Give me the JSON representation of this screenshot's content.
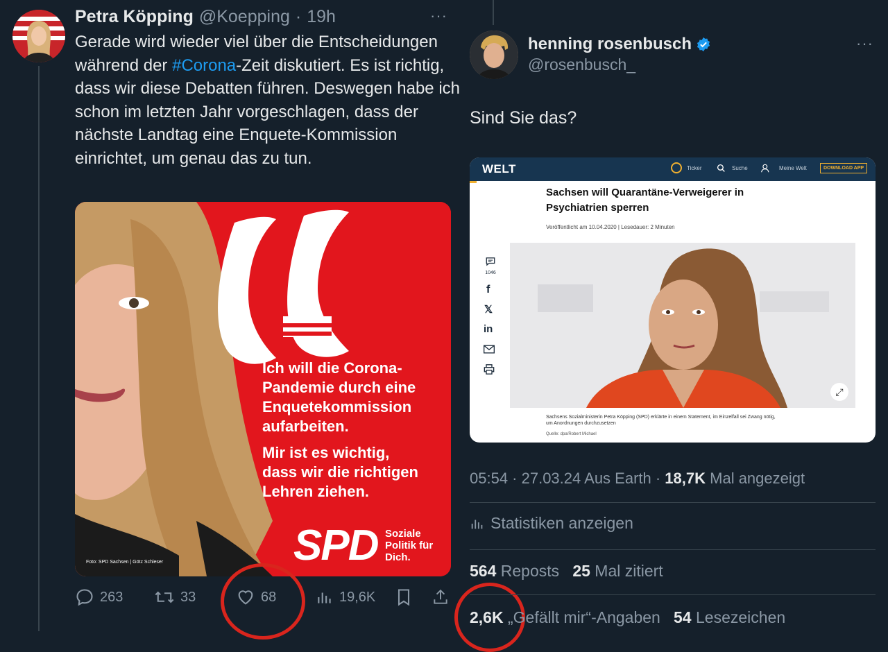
{
  "left_tweet": {
    "name": "Petra Köpping",
    "handle": "@Koepping",
    "time": "19h",
    "more": "···",
    "text_before": "Gerade wird wieder viel über die Entscheidungen während der ",
    "hashtag": "#Corona",
    "text_after": "-Zeit diskutiert. Es ist richtig, dass wir diese Debatten führen. Deswegen habe ich schon im letzten Jahr vorgeschlagen, dass der nächste Landtag eine Enquete-Kommission einrichtet, um genau das zu tun.",
    "image": {
      "quote_text_1": "Ich will die Corona-",
      "quote_text_2": "Pandemie durch eine",
      "quote_text_3": "Enquetekommission",
      "quote_text_4": "aufarbeiten.",
      "quote_text_5": "Mir ist es wichtig,",
      "quote_text_6": "dass wir die richtigen",
      "quote_text_7": "Lehren ziehen.",
      "logo": "SPD",
      "slogan_1": "Soziale",
      "slogan_2": "Politik für",
      "slogan_3": "Dich.",
      "credit": "Foto: SPD Sachsen | Götz Schleser",
      "bg_color": "#e2161d"
    },
    "actions": {
      "replies": "263",
      "reposts": "33",
      "likes": "68",
      "views": "19,6K"
    }
  },
  "right_tweet": {
    "name": "henning rosenbusch",
    "handle": "@rosenbusch_",
    "more": "···",
    "verified_color": "#1d9bf0",
    "text": "Sind Sie das?",
    "card": {
      "brand": "WELT",
      "nav_ticker": "Ticker",
      "nav_search": "Suche",
      "nav_account": "Meine Welt",
      "nav_app": "DOWNLOAD APP",
      "headline_1": "Sachsen will Quarantäne-Verweigerer in",
      "headline_2": "Psychiatrien sperren",
      "published": "Veröffentlicht am 10.04.2020 | Lesedauer: 2 Minuten",
      "comments": "1046",
      "caption_1": "Sachsens Sozialministerin Petra Köpping (SPD) erklärte in einem Statement, im Einzelfall sei Zwang nötig,",
      "caption_2": "um Anordnungen durchzusetzen",
      "source": "Quelle: dpa/Robert Michael"
    },
    "meta": {
      "time_date": "05:54 · 27.03.24 Aus Earth · ",
      "views": "18,7K",
      "views_label": " Mal angezeigt"
    },
    "stats_link": "Statistiken anzeigen",
    "reposts": "564",
    "reposts_label": "Reposts",
    "quotes": "25",
    "quotes_label": "Mal zitiert",
    "likes": "2,6K",
    "likes_label": "„Gefällt mir“-Angaben",
    "bookmarks": "54",
    "bookmarks_label": "Lesezeichen"
  }
}
